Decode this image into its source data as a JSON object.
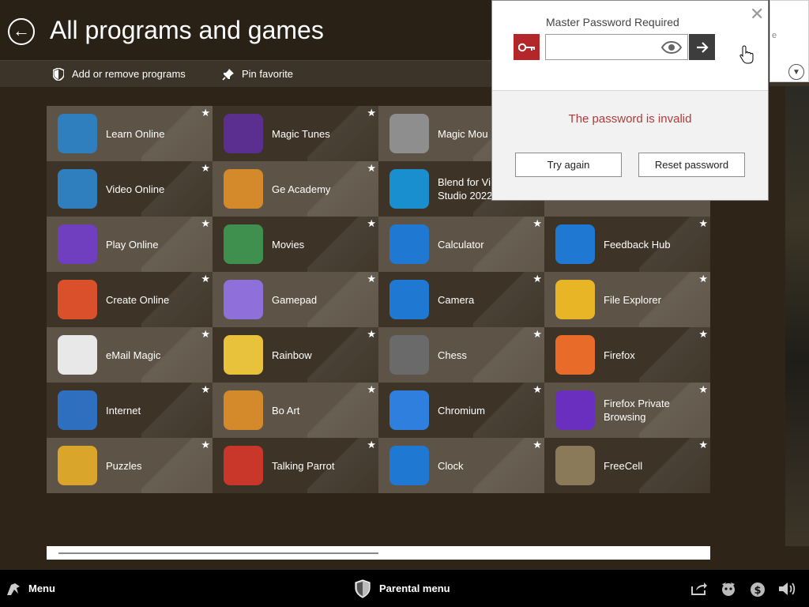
{
  "header": {
    "title": "All programs and games",
    "toolbar": {
      "add_remove": "Add or remove programs",
      "pin_favorite": "Pin favorite"
    }
  },
  "tiles": [
    {
      "label": "Learn Online",
      "icon": "learn-online-icon",
      "color": "#2f7fbf"
    },
    {
      "label": "Magic Tunes",
      "icon": "magic-tunes-icon",
      "color": "#5a2f8f"
    },
    {
      "label": "Magic Mou",
      "icon": "magic-mouse-icon",
      "color": "#8e8e8e"
    },
    {
      "label": "",
      "icon": "",
      "color": ""
    },
    {
      "label": "Video Online",
      "icon": "video-online-icon",
      "color": "#2f7fbf"
    },
    {
      "label": "Ge Academy",
      "icon": "ge-academy-icon",
      "color": "#d48a2a"
    },
    {
      "label": "Blend for Vi\nStudio 2022",
      "icon": "blend-vs-icon",
      "color": "#1a8fcf"
    },
    {
      "label": "",
      "icon": "",
      "color": ""
    },
    {
      "label": "Play Online",
      "icon": "play-online-icon",
      "color": "#6f3fbf"
    },
    {
      "label": "Movies",
      "icon": "movies-icon",
      "color": "#3f8f4f"
    },
    {
      "label": "Calculator",
      "icon": "calculator-icon",
      "color": "#1f78d1"
    },
    {
      "label": "Feedback Hub",
      "icon": "feedback-hub-icon",
      "color": "#1f78d1"
    },
    {
      "label": "Create Online",
      "icon": "create-online-icon",
      "color": "#d9502a"
    },
    {
      "label": "Gamepad",
      "icon": "gamepad-icon",
      "color": "#8f6fd9"
    },
    {
      "label": "Camera",
      "icon": "camera-icon",
      "color": "#1f78d1"
    },
    {
      "label": "File Explorer",
      "icon": "file-explorer-icon",
      "color": "#e8b526"
    },
    {
      "label": "eMail Magic",
      "icon": "email-magic-icon",
      "color": "#e8e8e8"
    },
    {
      "label": "Rainbow",
      "icon": "rainbow-icon",
      "color": "#e7c23a"
    },
    {
      "label": "Chess",
      "icon": "chess-icon",
      "color": "#6a6a6a"
    },
    {
      "label": "Firefox",
      "icon": "firefox-icon",
      "color": "#e86b2a"
    },
    {
      "label": "Internet",
      "icon": "internet-icon",
      "color": "#2f6fbf"
    },
    {
      "label": "Bo Art",
      "icon": "bo-art-icon",
      "color": "#d48a2a"
    },
    {
      "label": "Chromium",
      "icon": "chromium-icon",
      "color": "#2f7fdf"
    },
    {
      "label": "Firefox Private\nBrowsing",
      "icon": "firefox-private-icon",
      "color": "#6a2fbf"
    },
    {
      "label": "Puzzles",
      "icon": "puzzles-icon",
      "color": "#d9a52a"
    },
    {
      "label": "Talking Parrot",
      "icon": "talking-parrot-icon",
      "color": "#c9362a"
    },
    {
      "label": "Clock",
      "icon": "clock-icon",
      "color": "#1f78d1"
    },
    {
      "label": "FreeCell",
      "icon": "freecell-icon",
      "color": "#8a7a5a"
    }
  ],
  "dialog": {
    "label": "Master Password Required",
    "input_value": "",
    "error": "The password is invalid",
    "try_again": "Try again",
    "reset_password": "Reset password",
    "side_partial": "e"
  },
  "bottombar": {
    "menu": "Menu",
    "parental": "Parental menu"
  }
}
